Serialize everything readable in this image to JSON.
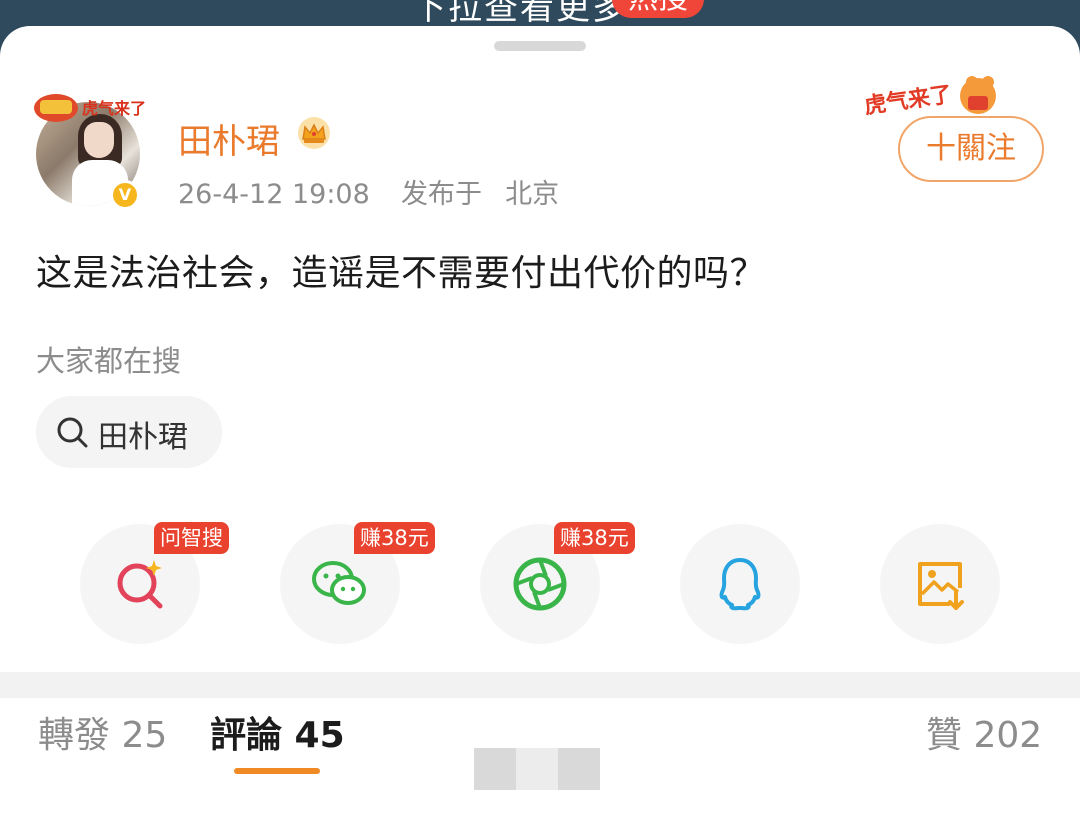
{
  "top_banner": {
    "text": "下拉查看更多",
    "badge": "热搜"
  },
  "post": {
    "username": "田朴珺",
    "timestamp": "26-4-12 19:08",
    "published_prefix": "发布于",
    "location": "北京",
    "verified_badge": "V",
    "follow_label": "十關注",
    "text": "这是法治社会，造谣是不需要付出代价的吗？"
  },
  "everyone_searching": {
    "label": "大家都在搜",
    "chip": "田朴珺"
  },
  "share_row": [
    {
      "icon": "ai-search-icon",
      "tag": "问智搜",
      "color": "#e2435a"
    },
    {
      "icon": "wechat-icon",
      "tag": "赚38元",
      "color": "#39b54a"
    },
    {
      "icon": "moments-icon",
      "tag": "赚38元",
      "color": "#39b54a"
    },
    {
      "icon": "qq-icon",
      "tag": "",
      "color": "#27a3e0"
    },
    {
      "icon": "save-image-icon",
      "tag": "",
      "color": "#f0a21f"
    }
  ],
  "tabs": {
    "repost": "轉發 25",
    "comment": "評論 45",
    "like": "贊 202"
  },
  "colors": {
    "accent": "#ea7a2c",
    "tag_red": "#e9432f",
    "underline": "#f08a24"
  }
}
